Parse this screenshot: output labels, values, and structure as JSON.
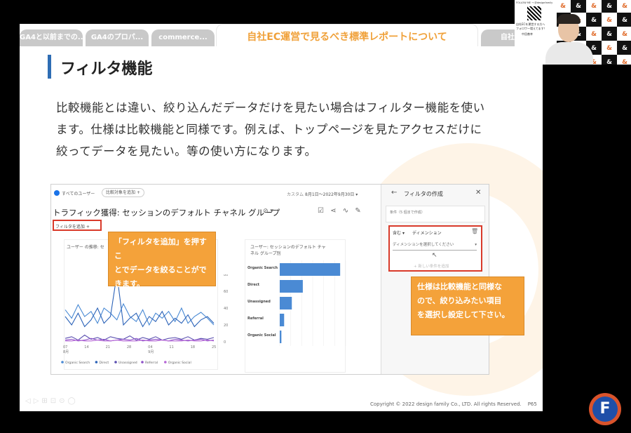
{
  "tabs": [
    {
      "label": "GA4と以前までの..."
    },
    {
      "label": "GA4のプロパ..."
    },
    {
      "label": "commerce..."
    },
    {
      "label": "自社EC運営で見るべき標準レポートについて"
    },
    {
      "label": "自社EC"
    }
  ],
  "slide": {
    "title": "フィルタ機能",
    "body_lines": [
      "比較機能とは違い、絞り込んだデータだけを見たい場合はフィルター機能を使い",
      "ます。仕様は比較機能と同様です。例えば、トップページを見たアクセスだけに",
      "絞ってデータを見たい。等の使い方になります。"
    ],
    "footer": "Copyright © 2022 design family Co., LTD. All rights Reserved.",
    "page": "P65"
  },
  "ga": {
    "all_users": "すべてのユーザー",
    "add_compare": "比較対象を追加",
    "custom": "カスタム",
    "date_range": "8月1日～2022年9月30日",
    "report_title": "トラフィック獲得: セッションのデフォルト チャネル グループ",
    "add_filter": "フィルタを追加",
    "line_chart_title": "ユーザー の推移: セ",
    "bar_chart_title_1": "ユーザー: セッションのデフォルト チャ",
    "bar_chart_title_2": "ネル グループ別",
    "legend": [
      "Organic Search",
      "Direct",
      "Unassigned",
      "Referral",
      "Organic Social"
    ],
    "filter_panel": {
      "title": "フィルタの作成",
      "condition_label": "条件（5 個まで作成）",
      "include": "含む",
      "dimension": "ディメンション",
      "dimension_placeholder": "ディメンションを選択してください",
      "add_condition": "+ 新しい条件を追加"
    }
  },
  "callouts": {
    "left": [
      "「フィルタを追加」を押すこ",
      "とでデータを絞ることがで",
      "きます。"
    ],
    "right": [
      "仕様は比較機能と同様な",
      "ので、絞り込みたい項目",
      "を選択し設定して下さい。"
    ]
  },
  "webcam": {
    "header": "FOLLOW ME → @designfamily",
    "caption_1": "自社ECを運営する方へ",
    "caption_2": "フォロワー増えてます！",
    "name": "中田善幸"
  },
  "chart_data": [
    {
      "type": "line",
      "x": [
        "07",
        "14",
        "21",
        "28",
        "04",
        "11",
        "18",
        "25"
      ],
      "x_month_labels": [
        "8月",
        "9月"
      ],
      "yticks": [
        0,
        20,
        40,
        60,
        80
      ],
      "ylim": [
        0,
        80
      ],
      "series": [
        {
          "name": "Organic Search",
          "values": [
            38,
            28,
            44,
            30,
            36,
            22,
            40,
            34,
            26,
            45,
            30,
            24,
            38,
            20,
            34,
            28,
            36,
            24,
            40,
            22,
            30,
            35,
            28,
            20
          ]
        },
        {
          "name": "Direct",
          "values": [
            30,
            20,
            34,
            18,
            26,
            40,
            22,
            30,
            80,
            20,
            28,
            34,
            18,
            30,
            24,
            36,
            20,
            28,
            22,
            32,
            18,
            26,
            30,
            22
          ]
        },
        {
          "name": "Unassigned",
          "values": [
            4,
            6,
            2,
            8,
            3,
            5,
            2,
            6,
            4,
            3,
            7,
            2,
            5,
            3,
            6,
            2,
            4,
            5,
            3,
            6,
            2,
            4,
            3,
            5
          ]
        },
        {
          "name": "Referral",
          "values": [
            2,
            3,
            1,
            2,
            4,
            2,
            3,
            1,
            2,
            3,
            2,
            4,
            1,
            2,
            3,
            2,
            1,
            3,
            2,
            1,
            2,
            3,
            1,
            2
          ]
        },
        {
          "name": "Organic Social",
          "values": [
            1,
            1,
            2,
            1,
            1,
            2,
            1,
            1,
            2,
            1,
            1,
            1,
            2,
            1,
            1,
            2,
            1,
            1,
            1,
            2,
            1,
            1,
            2,
            1
          ]
        }
      ]
    },
    {
      "type": "bar",
      "categories": [
        "Organic Search",
        "Direct",
        "Unassigned",
        "Referral",
        "Organic Social"
      ],
      "values": [
        1100,
        420,
        220,
        80,
        30
      ],
      "xticks": [
        "0",
        "200",
        "400",
        "600",
        "800",
        "1,000",
        "1,200"
      ],
      "xlim": [
        0,
        1200
      ]
    }
  ]
}
